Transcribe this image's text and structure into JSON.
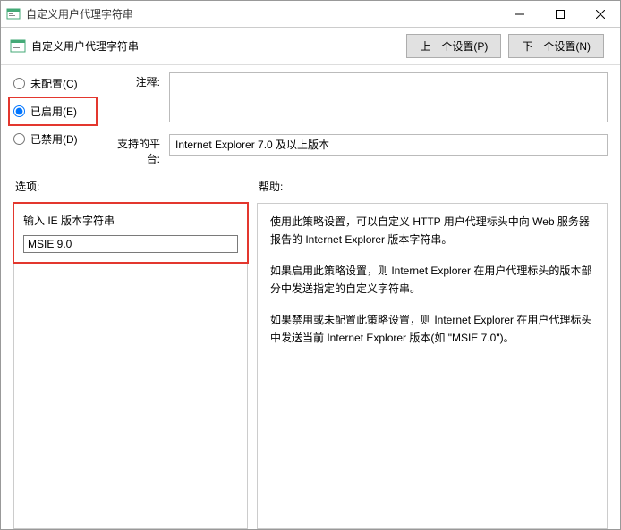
{
  "window": {
    "title": "自定义用户代理字符串"
  },
  "toolbar": {
    "title": "自定义用户代理字符串",
    "prev_label": "上一个设置(P)",
    "next_label": "下一个设置(N)"
  },
  "config": {
    "radio_not_configured": "未配置(C)",
    "radio_enabled": "已启用(E)",
    "radio_disabled": "已禁用(D)",
    "comment_label": "注释:",
    "comment_value": "",
    "platform_label": "支持的平台:",
    "platform_value": "Internet Explorer 7.0 及以上版本"
  },
  "options": {
    "section_label": "选项:",
    "input_label": "输入 IE 版本字符串",
    "input_value": "MSIE 9.0"
  },
  "help": {
    "section_label": "帮助:",
    "p1": "使用此策略设置，可以自定义 HTTP 用户代理标头中向 Web 服务器报告的 Internet Explorer 版本字符串。",
    "p2": "如果启用此策略设置，则 Internet Explorer 在用户代理标头的版本部分中发送指定的自定义字符串。",
    "p3": "如果禁用或未配置此策略设置，则 Internet Explorer 在用户代理标头中发送当前 Internet Explorer 版本(如 \"MSIE 7.0\")。"
  }
}
